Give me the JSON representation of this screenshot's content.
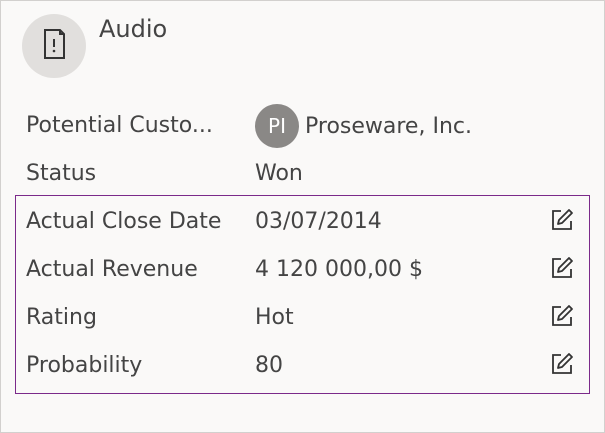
{
  "header": {
    "title": "Audio",
    "icon": "document-alert-icon"
  },
  "fields": [
    {
      "label": "Potential Custo...",
      "value": "Proseware, Inc.",
      "avatar_initials": "PI"
    },
    {
      "label": "Status",
      "value": "Won"
    },
    {
      "label": "Actual Close Date",
      "value": "03/07/2014",
      "editable": true
    },
    {
      "label": "Actual Revenue",
      "value": "4 120 000,00 $",
      "editable": true
    },
    {
      "label": "Rating",
      "value": "Hot",
      "editable": true
    },
    {
      "label": "Probability",
      "value": "80",
      "editable": true
    }
  ],
  "colors": {
    "editable_border": "#7b2a8a",
    "avatar_bg": "#8a8886",
    "icon_circle_bg": "#e1dfdd"
  }
}
